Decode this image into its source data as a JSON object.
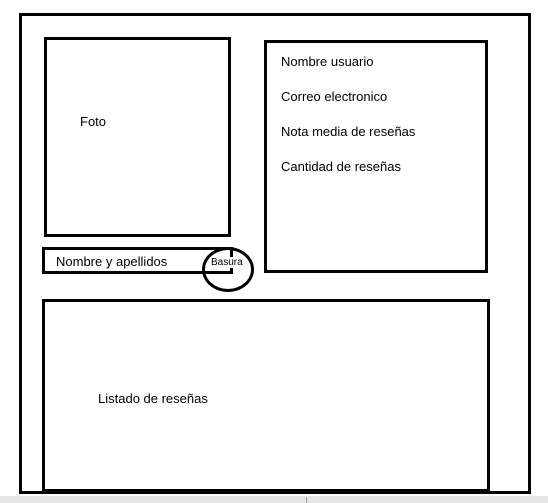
{
  "profile": {
    "photo_label": "Foto",
    "name_label": "Nombre y apellidos"
  },
  "user_info": {
    "items": [
      "Nombre usuario",
      "Correo electronico",
      "Nota media de reseñas",
      "Cantidad de reseñas"
    ]
  },
  "actions": {
    "trash_label": "Basura"
  },
  "reviews": {
    "label": "Listado de reseñas"
  }
}
